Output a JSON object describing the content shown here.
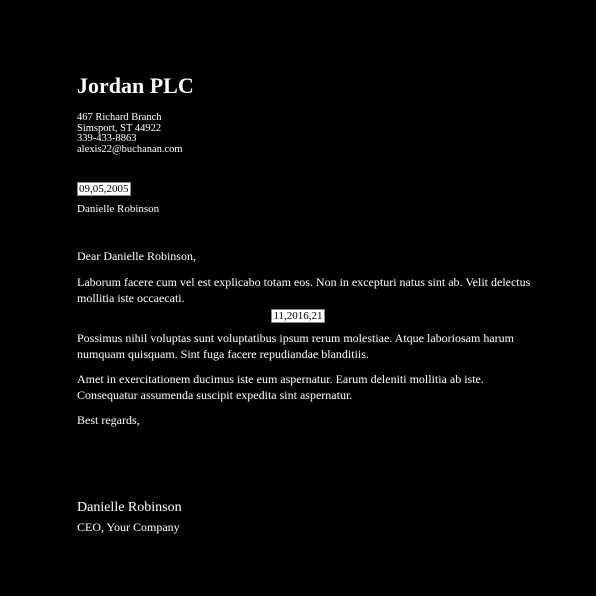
{
  "sender": {
    "company": "Jordan PLC",
    "address_lines": [
      "467 Richard Branch",
      "Simsport, ST 44922",
      "339-433-8863",
      "alexis22@buchanan.com"
    ]
  },
  "date": "09,05,2005",
  "recipient": "Danielle Robinson",
  "greeting": "Dear Danielle Robinson,",
  "paragraphs": [
    "Laborum facere cum vel est explicabo totam eos. Non in excepturi natus sint ab. Velit delectus mollitia iste occaecati.",
    "Possimus nihil voluptas sunt voluptatibus ipsum rerum molestiae. Atque laboriosam harum numquam quisquam. Sint fuga facere repudiandae blanditiis.",
    "Amet in exercitationem ducimus iste eum aspernatur. Earum deleniti mollitia ab iste. Consequatur assumenda suscipit expedita sint aspernatur."
  ],
  "inline_date": "11,2016,21",
  "closing": "Best regards,",
  "signature": {
    "name": "Danielle Robinson",
    "title": "CEO, Your Company"
  }
}
